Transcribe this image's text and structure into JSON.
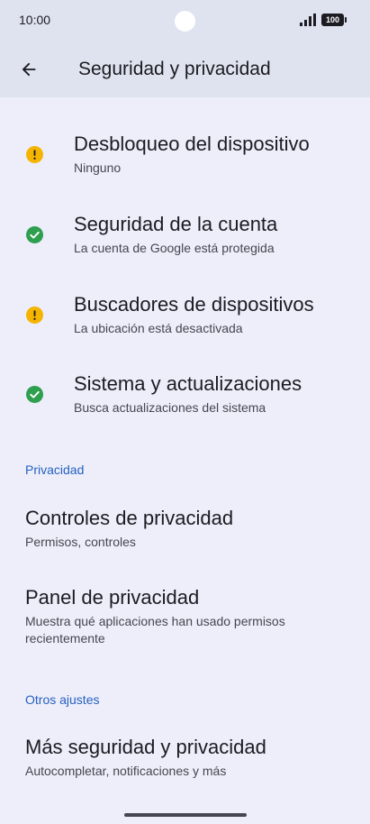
{
  "status_bar": {
    "time": "10:00",
    "battery": "100"
  },
  "header": {
    "title": "Seguridad y privacidad"
  },
  "security_items": [
    {
      "title": "Desbloqueo del dispositivo",
      "subtitle": "Ninguno",
      "status": "warning"
    },
    {
      "title": "Seguridad de la cuenta",
      "subtitle": "La cuenta de Google está protegida",
      "status": "ok"
    },
    {
      "title": "Buscadores de dispositivos",
      "subtitle": "La ubicación está desactivada",
      "status": "warning"
    },
    {
      "title": "Sistema y actualizaciones",
      "subtitle": "Busca actualizaciones del sistema",
      "status": "ok"
    }
  ],
  "privacy_section": {
    "header": "Privacidad",
    "items": [
      {
        "title": "Controles de privacidad",
        "subtitle": "Permisos, controles"
      },
      {
        "title": "Panel de privacidad",
        "subtitle": "Muestra qué aplicaciones han usado permisos recientemente"
      }
    ]
  },
  "other_section": {
    "header": "Otros ajustes",
    "items": [
      {
        "title": "Más seguridad y privacidad",
        "subtitle": "Autocompletar, notificaciones y más"
      }
    ]
  },
  "colors": {
    "warning": "#f4b400",
    "ok": "#2e9e4f",
    "accent": "#2561c0"
  }
}
